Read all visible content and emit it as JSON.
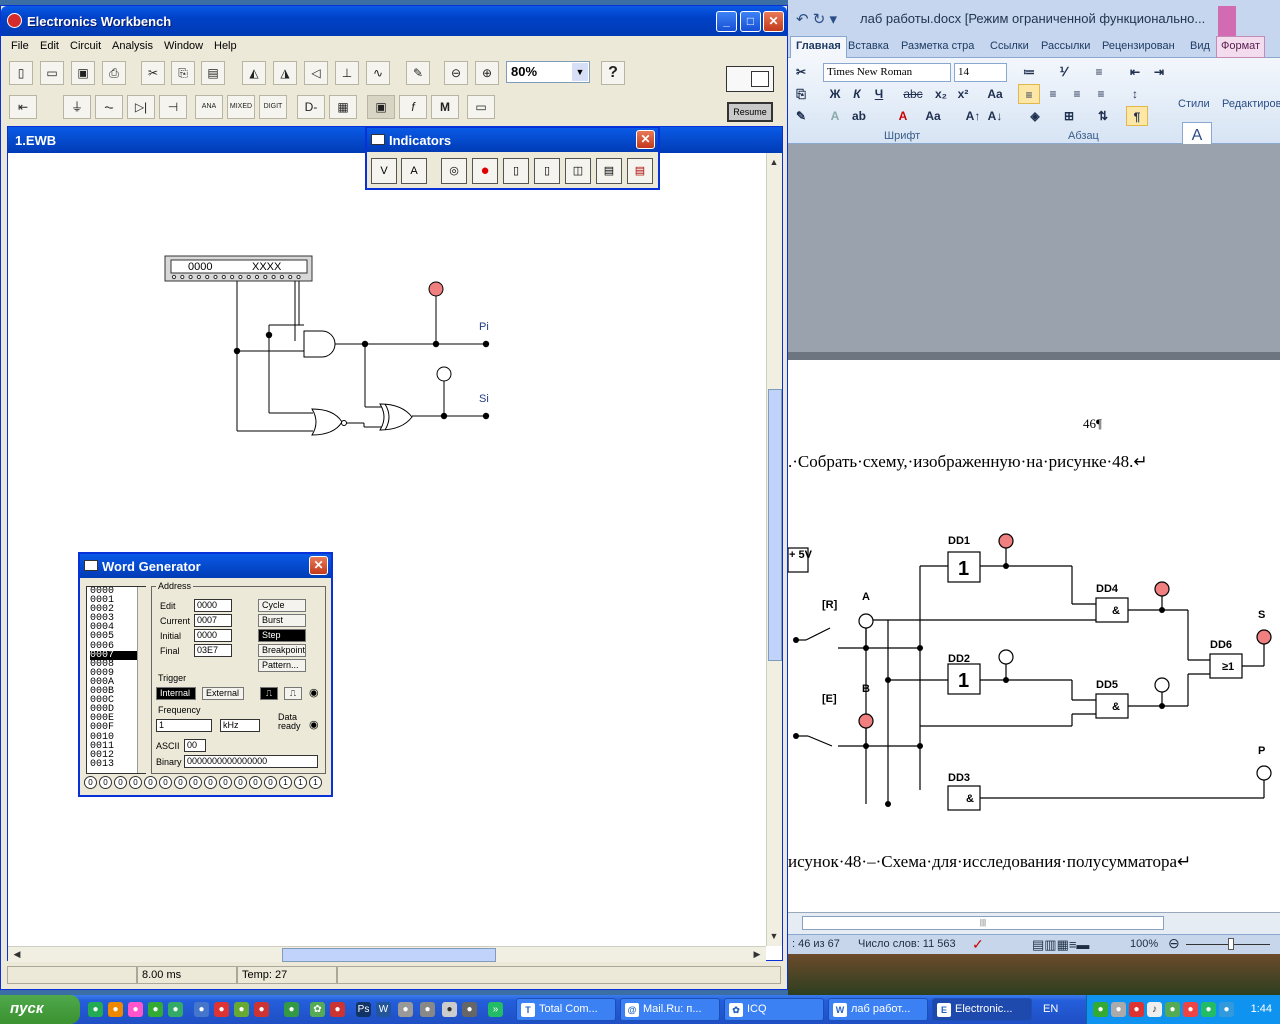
{
  "ewb": {
    "title": "Electronics Workbench",
    "menu": [
      "File",
      "Edit",
      "Circuit",
      "Analysis",
      "Window",
      "Help"
    ],
    "zoom": "80%",
    "help_label": "?",
    "resume_label": "Resume",
    "child_title": "1.EWB",
    "status": {
      "time": "8.00 ms",
      "temp": "Temp:  27"
    },
    "circuit": {
      "wordgen_display_left": "0000",
      "wordgen_display_right": "XXXX",
      "label_pi": "Pi",
      "label_si": "Si"
    }
  },
  "indicators": {
    "title": "Indicators",
    "icon_labels": [
      "V",
      "A"
    ]
  },
  "wordgen": {
    "title": "Word Generator",
    "list": [
      "0000",
      "0001",
      "0002",
      "0003",
      "0004",
      "0005",
      "0006",
      "0007",
      "0008",
      "0009",
      "000A",
      "000B",
      "000C",
      "000D",
      "000E",
      "000F",
      "0010",
      "0011",
      "0012",
      "0013"
    ],
    "selected_index": 7,
    "address_label": "Address",
    "edit_label": "Edit",
    "edit_value": "0000",
    "current_label": "Current",
    "current_value": "0007",
    "initial_label": "Initial",
    "initial_value": "0000",
    "final_label": "Final",
    "final_value": "03E7",
    "buttons": {
      "cycle": "Cycle",
      "burst": "Burst",
      "step": "Step",
      "breakpoint": "Breakpoint",
      "pattern": "Pattern..."
    },
    "trigger_label": "Trigger",
    "internal": "Internal",
    "external": "External",
    "frequency_label": "Frequency",
    "freq_value": "1",
    "freq_unit": "kHz",
    "data_ready": "Data ready",
    "ascii_label": "ASCII",
    "ascii_value": "00",
    "binary_label": "Binary",
    "binary_value": "0000000000000000",
    "bits": [
      "0",
      "0",
      "0",
      "0",
      "0",
      "0",
      "0",
      "0",
      "0",
      "0",
      "0",
      "0",
      "0",
      "1",
      "1",
      "1"
    ]
  },
  "word": {
    "title": "лаб работы.docx [Режим ограниченной функционально...",
    "tabs": [
      "Главная",
      "Вставка",
      "Разметка стра",
      "Ссылки",
      "Рассылки",
      "Рецензирован",
      "Вид",
      "Формат"
    ],
    "font_name": "Times New Roman",
    "font_size": "14",
    "group_font": "Шрифт",
    "group_para": "Абзац",
    "styles": "Стили",
    "editing": "Редактиров",
    "page_number": "46¶",
    "line1": ".·Собрать·схему,·изображенную·на·рисунке·48.↵",
    "caption": "исунок·48·–·Схема·для·исследования·полусумматора↵",
    "figure": {
      "power": "+ 5V",
      "switch_r": "[R]",
      "switch_e": "[E]",
      "a": "A",
      "b": "B",
      "s": "S",
      "p": "P",
      "dd1": "DD1",
      "dd2": "DD2",
      "dd3": "DD3",
      "dd4": "DD4",
      "dd5": "DD5",
      "dd6": "DD6",
      "gate_not": "1",
      "gate_and": "&",
      "gate_or": "≥1"
    },
    "status_page": ": 46 из 67",
    "status_words": "Число слов: 11 563",
    "status_zoom": "100%"
  },
  "taskbar": {
    "start": "пуск",
    "tasks": [
      "Total Com...",
      "Mail.Ru: п...",
      "ICQ",
      "лаб работ...",
      "Electronic..."
    ],
    "lang": "EN",
    "clock": "1:44"
  }
}
